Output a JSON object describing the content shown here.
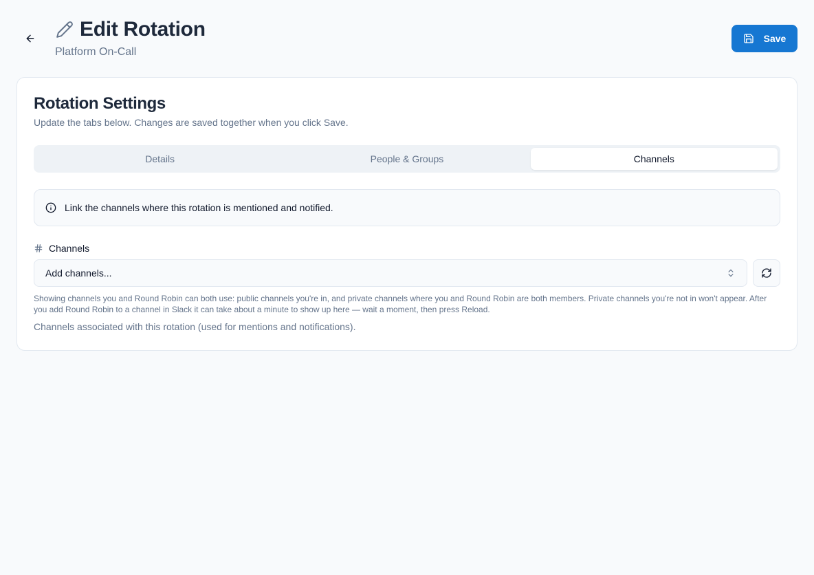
{
  "header": {
    "title": "Edit Rotation",
    "subtitle": "Platform On-Call",
    "save_label": "Save"
  },
  "card": {
    "title": "Rotation Settings",
    "description": "Update the tabs below. Changes are saved together when you click Save."
  },
  "tabs": [
    {
      "label": "Details",
      "active": false
    },
    {
      "label": "People & Groups",
      "active": false
    },
    {
      "label": "Channels",
      "active": true
    }
  ],
  "info": {
    "text": "Link the channels where this rotation is mentioned and notified."
  },
  "channels_field": {
    "label": "Channels",
    "placeholder": "Add channels...",
    "help": "Showing channels you and Round Robin can both use: public channels you're in, and private channels where you and Round Robin are both members. Private channels you're not in won't appear. After you add Round Robin to a channel in Slack it can take about a minute to show up here — wait a moment, then press Reload.",
    "description": "Channels associated with this rotation (used for mentions and notifications)."
  },
  "icons": {
    "back": "arrow-left-icon",
    "title": "pencil-icon",
    "save": "save-icon",
    "info": "info-icon",
    "hash": "hash-icon",
    "select": "chevrons-up-down-icon",
    "reload": "refresh-icon"
  },
  "colors": {
    "primary": "#1677d2",
    "background": "#f8fafc",
    "text": "#0f172a",
    "muted": "#64748b",
    "border": "#e2e8f0"
  }
}
